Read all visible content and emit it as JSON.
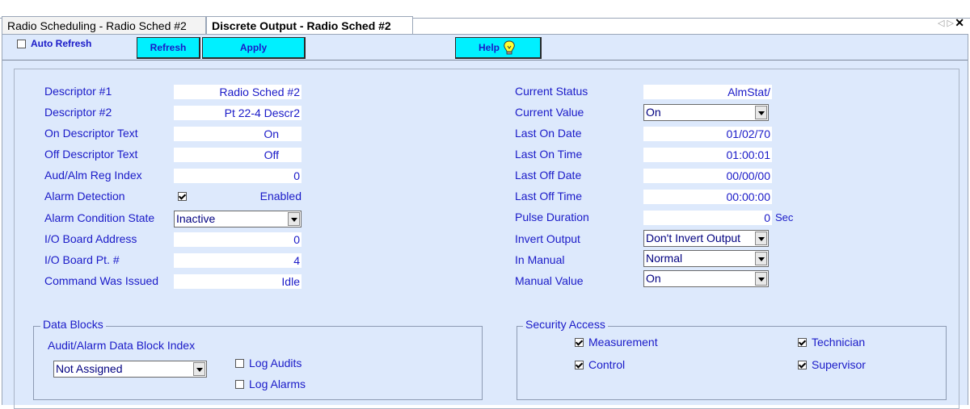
{
  "tabs": [
    {
      "label": "Radio Scheduling - Radio Sched #2",
      "active": false
    },
    {
      "label": "Discrete Output - Radio Sched #2",
      "active": true
    }
  ],
  "tab_controls": {
    "arrows": "◁ ▷",
    "close": "✕"
  },
  "toolbar": {
    "auto_refresh_label": "Auto Refresh",
    "auto_refresh_checked": false,
    "refresh_label": "Refresh",
    "apply_label": "Apply",
    "help_label": "Help"
  },
  "left_fields": {
    "descriptor1": {
      "label": "Descriptor #1",
      "value": "Radio Sched #2"
    },
    "descriptor2": {
      "label": "Descriptor #2",
      "value": "Pt 22-4 Descr2"
    },
    "on_text": {
      "label": "On Descriptor Text",
      "value": "On"
    },
    "off_text": {
      "label": "Off Descriptor Text",
      "value": "Off"
    },
    "aud_alm": {
      "label": "Aud/Alm Reg Index",
      "value": "0"
    },
    "alarm_detection": {
      "label": "Alarm Detection",
      "checked": true,
      "value": "Enabled"
    },
    "alarm_condition": {
      "label": "Alarm Condition State",
      "value": "Inactive"
    },
    "io_address": {
      "label": "I/O Board Address",
      "value": "0"
    },
    "io_point": {
      "label": "I/O Board Pt. #",
      "value": "4"
    },
    "command": {
      "label": "Command Was Issued",
      "value": "Idle"
    }
  },
  "right_fields": {
    "current_status": {
      "label": "Current Status",
      "value": "AlmStat/"
    },
    "current_value": {
      "label": "Current Value",
      "value": "On"
    },
    "last_on_date": {
      "label": "Last On Date",
      "value": "01/02/70"
    },
    "last_on_time": {
      "label": "Last On Time",
      "value": "01:00:01"
    },
    "last_off_date": {
      "label": "Last Off Date",
      "value": "00/00/00"
    },
    "last_off_time": {
      "label": "Last Off Time",
      "value": "00:00:00"
    },
    "pulse_duration": {
      "label": "Pulse Duration",
      "value": "0",
      "unit": "Sec"
    },
    "invert_output": {
      "label": "Invert Output",
      "value": "Don't Invert Output"
    },
    "in_manual": {
      "label": "In Manual",
      "value": "Normal"
    },
    "manual_value": {
      "label": "Manual Value",
      "value": "On"
    }
  },
  "data_blocks": {
    "legend": "Data Blocks",
    "index_label": "Audit/Alarm Data Block Index",
    "index_value": "Not Assigned",
    "log_audits": {
      "label": "Log Audits",
      "checked": false
    },
    "log_alarms": {
      "label": "Log Alarms",
      "checked": false
    }
  },
  "security": {
    "legend": "Security Access",
    "measurement": {
      "label": "Measurement",
      "checked": true
    },
    "control": {
      "label": "Control",
      "checked": true
    },
    "technician": {
      "label": "Technician",
      "checked": true
    },
    "supervisor": {
      "label": "Supervisor",
      "checked": true
    }
  },
  "colors": {
    "panel_bg": "#dde9fc",
    "button_bg": "#00f0ff",
    "label_text": "#1a1ac8"
  }
}
